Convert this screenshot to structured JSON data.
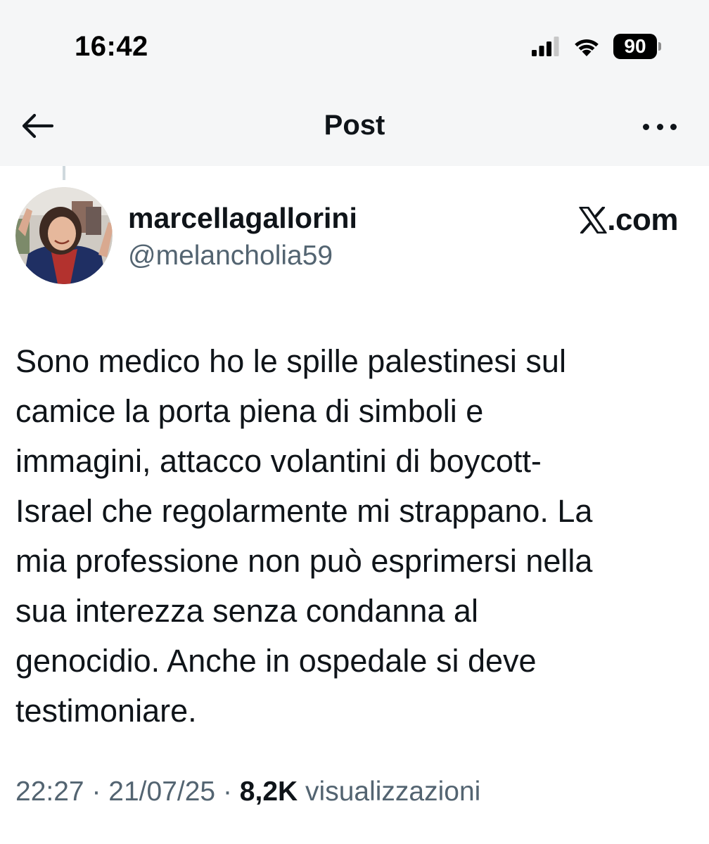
{
  "status_bar": {
    "time": "16:42",
    "battery_level": "90",
    "icons": [
      "cellular-signal-icon",
      "wifi-icon",
      "battery-icon"
    ]
  },
  "nav": {
    "title": "Post",
    "back_icon": "arrow-left-icon",
    "more_icon": "more-horizontal-icon"
  },
  "author": {
    "display_name": "marcellagallorini",
    "handle": "@melancholia59",
    "source_label": ".com",
    "source_icon": "x-logo-icon"
  },
  "tweet": {
    "text": "Sono medico ho le spille palestinesi sul\ncamice la porta piena di simboli e\nimmagini, attacco volantini di boycott-\nIsrael che regolarmente mi strappano. La\nmia professione non può esprimersi nella\nsua interezza senza condanna  al\ngenocidio. Anche in ospedale si deve\ntestimoniare."
  },
  "meta": {
    "time": "22:27",
    "separator": "·",
    "date": "21/07/25",
    "views_count": "8,2K",
    "views_label": "visualizzazioni"
  },
  "colors": {
    "text_primary": "#0f1419",
    "text_secondary": "#536471",
    "top_bg": "#f5f6f7",
    "background": "#ffffff"
  }
}
